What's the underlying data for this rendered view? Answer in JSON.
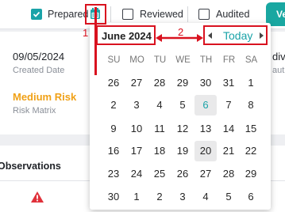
{
  "toolbar": {
    "prepared_label": "Prepared",
    "reviewed_label": "Reviewed",
    "audited_label": "Audited",
    "ve_label": "Ve"
  },
  "card": {
    "date_value": "09/05/2024",
    "date_label": "Created Date",
    "risk_value": "Medium Risk",
    "risk_label": "Risk Matrix",
    "right_value": "div",
    "right_label": "aut"
  },
  "observations": {
    "title": "Observations"
  },
  "calendar": {
    "month_label": "June 2024",
    "today_label": "Today",
    "weekdays": [
      "SU",
      "MO",
      "TU",
      "WE",
      "TH",
      "FR",
      "SA"
    ],
    "weeks": [
      [
        "26",
        "27",
        "28",
        "29",
        "30",
        "31",
        "1"
      ],
      [
        "2",
        "3",
        "4",
        "5",
        "6",
        "7",
        "8"
      ],
      [
        "9",
        "10",
        "11",
        "12",
        "13",
        "14",
        "15"
      ],
      [
        "16",
        "17",
        "18",
        "19",
        "20",
        "21",
        "22"
      ],
      [
        "23",
        "24",
        "25",
        "26",
        "27",
        "28",
        "29"
      ],
      [
        "30",
        "1",
        "2",
        "3",
        "4",
        "5",
        "6"
      ]
    ]
  },
  "annotations": {
    "label_1": "1",
    "label_2": "2"
  },
  "colors": {
    "accent": "#1aa3a8",
    "annotation": "#d9121f",
    "risk_medium": "#f0a117"
  }
}
